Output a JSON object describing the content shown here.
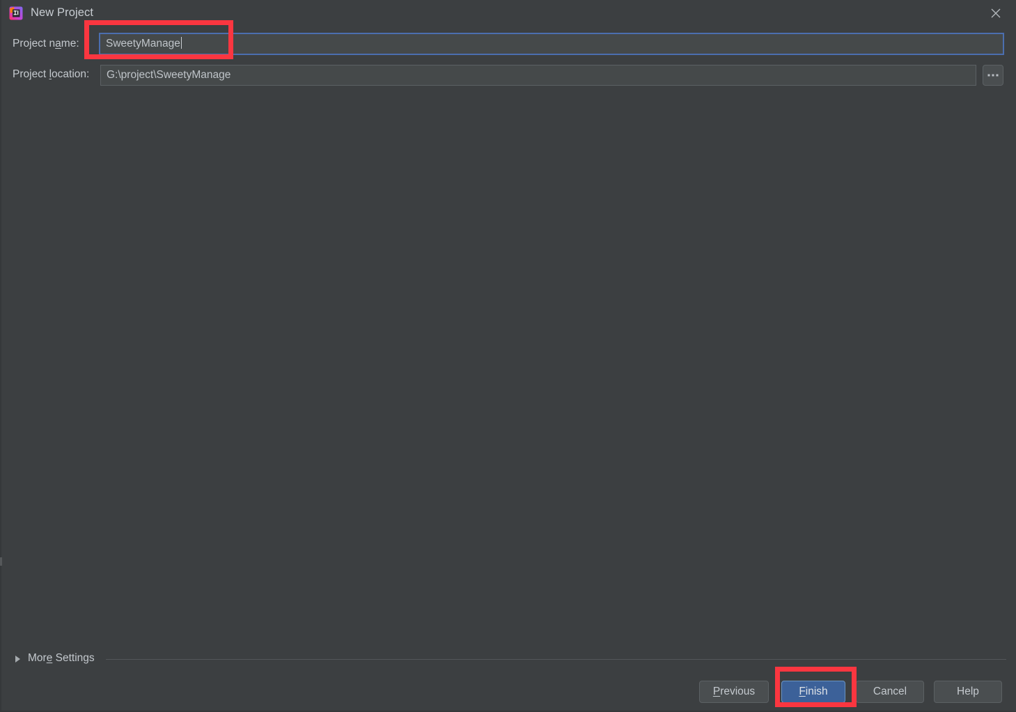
{
  "window": {
    "title": "New Project",
    "app_icon": "intellij-idea-icon",
    "close_icon": "close-icon"
  },
  "form": {
    "project_name": {
      "label_prefix": "Project n",
      "label_mnemonic": "a",
      "label_suffix": "me:",
      "label_full": "Project name:",
      "value": "SweetyManage",
      "focused": true
    },
    "project_location": {
      "label_prefix": "Project ",
      "label_mnemonic": "l",
      "label_suffix": "ocation:",
      "label_full": "Project location:",
      "value": "G:\\project\\SweetyManage",
      "browse_icon": "ellipsis-icon",
      "browse_label": "..."
    }
  },
  "more_settings": {
    "label_prefix": "Mor",
    "label_mnemonic": "e",
    "label_suffix": " Settings",
    "label_full": "More Settings",
    "expanded": false,
    "arrow_icon": "chevron-right-icon"
  },
  "buttons": {
    "previous": {
      "prefix": "",
      "mnemonic": "P",
      "suffix": "revious",
      "full": "Previous"
    },
    "finish": {
      "prefix": "",
      "mnemonic": "F",
      "suffix": "inish",
      "full": "Finish"
    },
    "cancel": {
      "prefix": "",
      "mnemonic": "",
      "suffix": "Cancel",
      "full": "Cancel"
    },
    "help": {
      "prefix": "",
      "mnemonic": "",
      "suffix": "Help",
      "full": "Help"
    }
  },
  "annotations": [
    {
      "name": "project-name-highlight",
      "color": "#fb3640",
      "target": "project-name-input"
    },
    {
      "name": "finish-button-highlight",
      "color": "#fb3640",
      "target": "finish-button"
    }
  ],
  "colors": {
    "background": "#3c3f41",
    "field_background": "#45494a",
    "focus_border": "#4b6eaf",
    "primary_button": "#3c6199",
    "text": "#c4c9ce",
    "annotation": "#fb3640"
  }
}
